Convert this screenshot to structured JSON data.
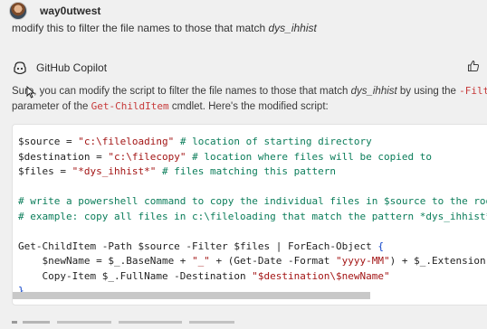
{
  "user": {
    "name": "way0utwest"
  },
  "user_message": {
    "prefix": "modify this to filter the file names to those that match ",
    "emph": "dys_ihhist"
  },
  "assistant": {
    "name": "GitHub Copilot"
  },
  "response": {
    "p1_a": "Sure, you can modify the script to filter the file names to those that match ",
    "p1_emph": "dys_ihhist",
    "p1_b": " by using the ",
    "p1_kw1": "-Filter",
    "p2_a": "parameter of the ",
    "p2_kw": "Get-ChildItem",
    "p2_b": " cmdlet. Here's the modified script:"
  },
  "code": {
    "l1_var": "$source",
    "l1_eq": " = ",
    "l1_str": "\"c:\\fileloading\"",
    "l1_com": " # location of starting directory",
    "l2_var": "$destination",
    "l2_eq": " = ",
    "l2_str": "\"c:\\filecopy\"",
    "l2_com": " # location where files will be copied to",
    "l3_var": "$files",
    "l3_eq": " = ",
    "l3_str": "\"*dys_ihhist*\"",
    "l3_com": " # files matching this pattern",
    "l5_com": "# write a powershell command to copy the individual files in $source to the root of",
    "l6_com": "# example: copy all files in c:\\fileloading that match the pattern *dys_ihhist*.txt",
    "l8_a": "Get-ChildItem -Path $source -Filter $files | ForEach-Object ",
    "l8_brace": "{",
    "l9_a": "    $newName = $_.BaseName + ",
    "l9_s1": "\"_\"",
    "l9_b": " + (Get-Date -Format ",
    "l9_s2": "\"yyyy-MM\"",
    "l9_c": ") + $_.Extension",
    "l10_a": "    Copy-Item $_.FullName -Destination ",
    "l10_s": "\"$destination\\$newName\"",
    "l11_brace": "}"
  },
  "icons": {
    "avatar": "user-avatar",
    "copilot": "copilot-icon",
    "thumbs_up": "thumbs-up-icon",
    "cursor": "mouse-cursor-icon"
  },
  "colors": {
    "background": "#f0f0f0",
    "code_bg": "#ffffff",
    "keyword": "#c73a3a",
    "string": "#a31515",
    "comment": "#0b7d5a",
    "brace": "#0b40c8"
  }
}
